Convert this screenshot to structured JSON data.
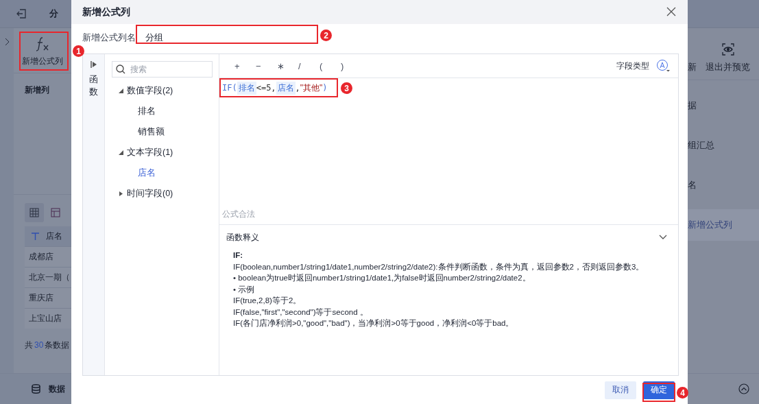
{
  "app": {
    "topbar": {
      "title": "分"
    },
    "toolbar": {
      "add_formula": "新增公式列",
      "update": "新",
      "exit_preview": "退出并预览"
    },
    "left": {
      "section": "新增列",
      "table": {
        "header": "店名",
        "rows": [
          "成都店",
          "北京一期（",
          "重庆店",
          "上宝山店"
        ]
      },
      "total": {
        "prefix": "共",
        "count": "30",
        "suffix": "条数据"
      },
      "bottom_tab": "数据"
    },
    "right_steps": [
      {
        "label": "据",
        "selected": false
      },
      {
        "label": "组汇总",
        "selected": false
      },
      {
        "label": "名",
        "selected": false
      },
      {
        "label": "新增公式列",
        "selected": true
      }
    ]
  },
  "dialog": {
    "title": "新增公式列",
    "name_label": "新增公式列名",
    "name_value": "分组",
    "function_tab": "函数",
    "search": {
      "placeholder": "搜索"
    },
    "field_groups": [
      {
        "label": "数值字段(2)",
        "expanded": true,
        "children": [
          {
            "label": "排名",
            "selected": false
          },
          {
            "label": "销售额",
            "selected": false
          }
        ]
      },
      {
        "label": "文本字段(1)",
        "expanded": true,
        "children": [
          {
            "label": "店名",
            "selected": true
          }
        ]
      },
      {
        "label": "时间字段(0)",
        "expanded": false
      }
    ],
    "operators": [
      "+",
      "−",
      "∗",
      "/",
      "(",
      ")"
    ],
    "field_type_label": "字段类型",
    "formula": [
      {
        "kind": "func",
        "text": "IF("
      },
      {
        "kind": "field",
        "text": "排名"
      },
      {
        "kind": "plain",
        "text": "<=5,"
      },
      {
        "kind": "field",
        "text": "店名"
      },
      {
        "kind": "plain",
        "text": ","
      },
      {
        "kind": "string",
        "text": "\"其他\""
      },
      {
        "kind": "func",
        "text": ")"
      }
    ],
    "status": "公式合法",
    "help": {
      "title": "函数释义",
      "expanded": true,
      "heading": "IF:",
      "lines": [
        "IF(boolean,number1/string1/date1,number2/string2/date2):条件判断函数，条件为真，返回参数2，否则返回参数3。",
        "• boolean为true时返回number1/string1/date1,为false时返回number2/string2/date2。",
        "• 示例",
        "IF(true,2,8)等于2。",
        "IF(false,\"first\",\"second\")等于second 。",
        "IF(各门店净利润>0,\"good\",\"bad\")，当净利润>0等于good，净利润<0等于bad。"
      ]
    },
    "buttons": [
      {
        "label": "取消",
        "kind": "secondary"
      },
      {
        "label": "确定",
        "kind": "primary"
      }
    ]
  },
  "annotations": [
    {
      "number": "1"
    },
    {
      "number": "2"
    },
    {
      "number": "3"
    },
    {
      "number": "4"
    }
  ]
}
